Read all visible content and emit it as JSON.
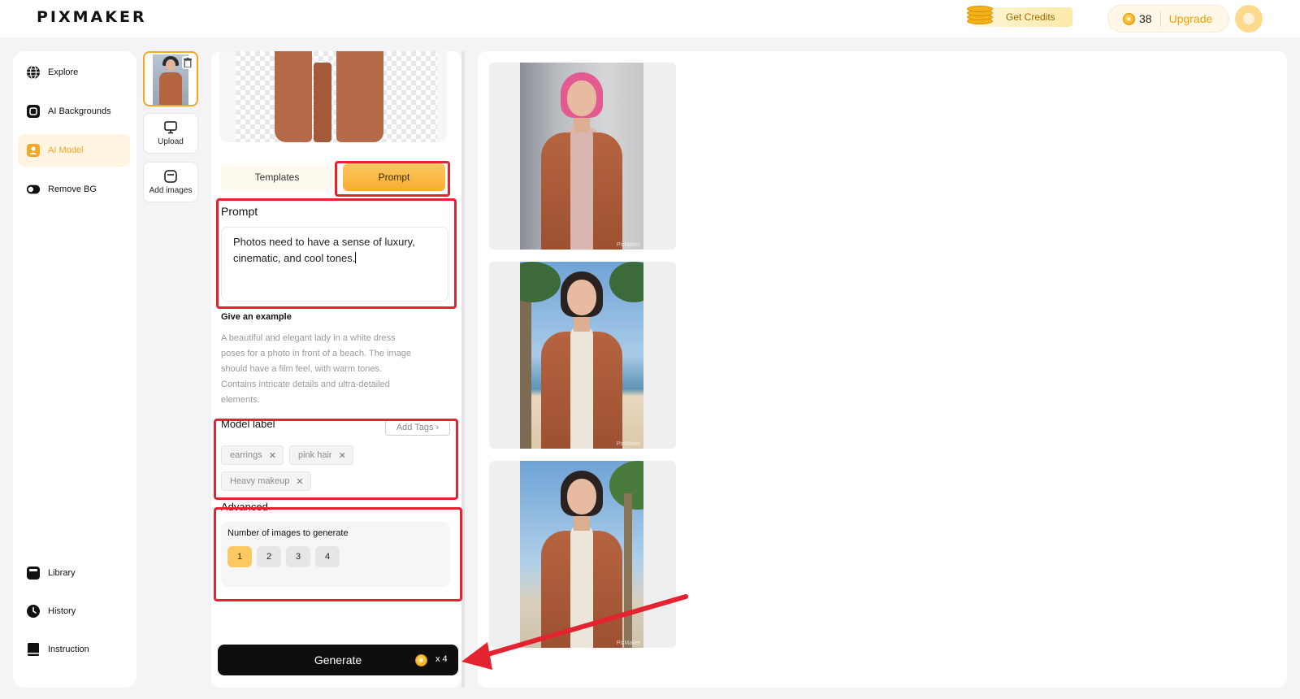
{
  "header": {
    "logo": "PIXMAKER",
    "get_credits": "Get Credits",
    "credits_count": "38",
    "upgrade": "Upgrade"
  },
  "nav": {
    "top": [
      {
        "label": "Explore",
        "icon": "globe-icon"
      },
      {
        "label": "AI Backgrounds",
        "icon": "image-frame-icon"
      },
      {
        "label": "AI Model",
        "icon": "person-icon",
        "active": true
      },
      {
        "label": "Remove BG",
        "icon": "toggle-icon"
      }
    ],
    "bottom": [
      {
        "label": "Library",
        "icon": "library-icon"
      },
      {
        "label": "History",
        "icon": "clock-icon"
      },
      {
        "label": "Instruction",
        "icon": "book-icon"
      }
    ]
  },
  "sidebar_tools": {
    "upload": "Upload",
    "add_images": "Add images"
  },
  "tabs": {
    "templates": "Templates",
    "prompt": "Prompt"
  },
  "prompt": {
    "title": "Prompt",
    "line1": "Photos need to have a sense of luxury,",
    "line2": "cinematic, and cool tones."
  },
  "example": {
    "title": "Give an example",
    "line1": "A beautiful and elegant lady in a white dress",
    "line2": "poses for a photo in front of a beach. The image",
    "line3": "should have a film feel, with warm tones.",
    "line4": "Contains intricate details and ultra-detailed",
    "line5": "elements."
  },
  "model_label": {
    "title": "Model label",
    "add_tags": "Add Tags",
    "tags": [
      "earrings",
      "pink hair",
      "Heavy makeup"
    ]
  },
  "advanced": {
    "title": "Advanced",
    "num_label": "Number of images to generate",
    "options": [
      "1",
      "2",
      "3",
      "4"
    ],
    "selected": "1"
  },
  "generate": {
    "label": "Generate",
    "cost": "x 4"
  },
  "results": {
    "watermark": "PixMaker"
  },
  "colors": {
    "accent": "#f5a623",
    "highlight": "#e3232f",
    "generate_bg": "#0e0e0e"
  }
}
